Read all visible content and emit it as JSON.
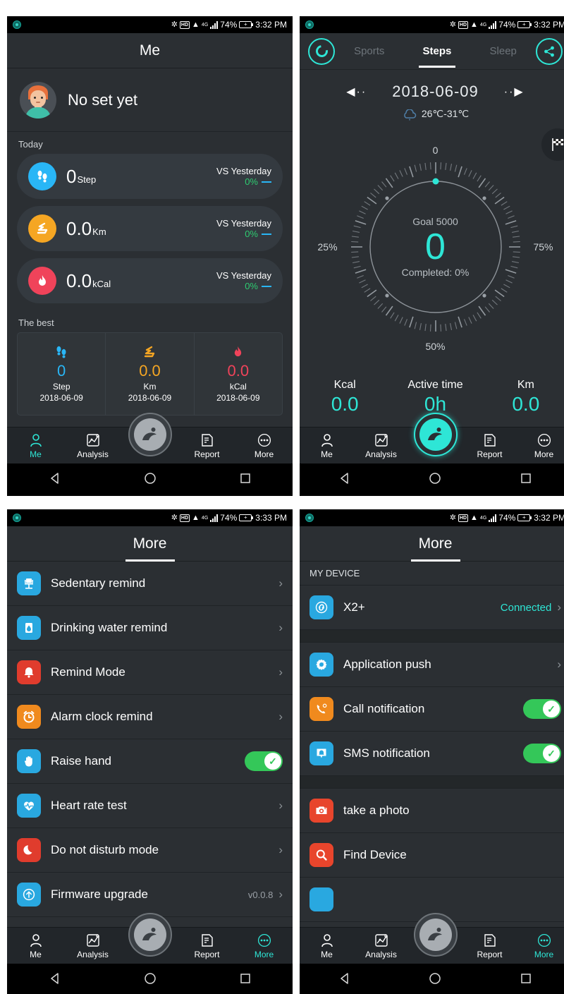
{
  "statusbar": {
    "battery_pct": "74%",
    "network": "4G",
    "hd": "HD",
    "time_332": "3:32 PM",
    "time_333": "3:33 PM"
  },
  "bottom_nav": {
    "items": [
      {
        "label": "Me",
        "icon": "person-icon"
      },
      {
        "label": "Analysis",
        "icon": "chart-icon"
      },
      {
        "label": "",
        "icon": "run-logo-icon"
      },
      {
        "label": "Report",
        "icon": "document-icon"
      },
      {
        "label": "More",
        "icon": "ellipsis-icon"
      }
    ]
  },
  "android_nav": {
    "back": "back-icon",
    "home": "home-icon",
    "recents": "recents-icon"
  },
  "me_page": {
    "title": "Me",
    "profile_name": "No set yet",
    "today_label": "Today",
    "today_stats": [
      {
        "icon": "footsteps-icon",
        "color": "#29b6f6",
        "value": "0",
        "unit": "Step",
        "vs_label": "VS Yesterday",
        "change": "0%"
      },
      {
        "icon": "distance-icon",
        "color": "#f5a623",
        "value": "0.0",
        "unit": "Km",
        "vs_label": "VS Yesterday",
        "change": "0%"
      },
      {
        "icon": "flame-icon",
        "color": "#f0435a",
        "value": "0.0",
        "unit": "kCal",
        "vs_label": "VS Yesterday",
        "change": "0%"
      }
    ],
    "best_label": "The best",
    "best_stats": [
      {
        "icon": "footsteps-icon",
        "color": "#29b6f6",
        "value": "0",
        "unit": "Step",
        "date": "2018-06-09"
      },
      {
        "icon": "distance-icon",
        "color": "#f5a623",
        "value": "0.0",
        "unit": "Km",
        "date": "2018-06-09"
      },
      {
        "icon": "flame-icon",
        "color": "#f0435a",
        "value": "0.0",
        "unit": "kCal",
        "date": "2018-06-09"
      }
    ]
  },
  "steps_page": {
    "tabs": [
      {
        "label": "Sports",
        "active": false
      },
      {
        "label": "Steps",
        "active": true
      },
      {
        "label": "Sleep",
        "active": false
      }
    ],
    "date": "2018-06-09",
    "prev_arrow": "◀··",
    "next_arrow": "··▶",
    "weather": "26℃-31℃",
    "gauge": {
      "top_label": "0",
      "right_label": "75%",
      "bottom_label": "50%",
      "left_label": "25%",
      "goal_label": "Goal 5000",
      "count": "0",
      "completed_label": "Completed: 0%",
      "progress_pct": 0,
      "accent": "#2ee6d6"
    },
    "metrics": [
      {
        "label": "Kcal",
        "value": "0.0"
      },
      {
        "label": "Active time",
        "value": "0h"
      },
      {
        "label": "Km",
        "value": "0.0"
      }
    ]
  },
  "more_page": {
    "title": "More",
    "rows": [
      {
        "label": "Sedentary remind",
        "icon": "chair-icon",
        "color": "#29a8e0",
        "control": "chevron"
      },
      {
        "label": "Drinking water remind",
        "icon": "water-glass-icon",
        "color": "#29a8e0",
        "control": "chevron"
      },
      {
        "label": "Remind Mode",
        "icon": "bell-icon",
        "color": "#e03c2d",
        "control": "chevron"
      },
      {
        "label": "Alarm clock remind",
        "icon": "alarm-clock-icon",
        "color": "#f08a1e",
        "control": "chevron"
      },
      {
        "label": "Raise hand",
        "icon": "hand-icon",
        "color": "#29a8e0",
        "control": "toggle",
        "on": true
      },
      {
        "label": "Heart rate test",
        "icon": "heart-pulse-icon",
        "color": "#29a8e0",
        "control": "chevron"
      },
      {
        "label": "Do not disturb mode",
        "icon": "moon-icon",
        "color": "#e03c2d",
        "control": "chevron"
      },
      {
        "label": "Firmware upgrade",
        "icon": "upload-circle-icon",
        "color": "#29a8e0",
        "control": "chevron",
        "value": "v0.0.8"
      }
    ]
  },
  "device_page": {
    "title": "More",
    "group_header": "MY DEVICE",
    "rows": [
      {
        "label": "X2+",
        "icon": "link-icon",
        "color": "#29a8e0",
        "control": "chevron",
        "value": "Connected",
        "value_style": "cyan"
      },
      {
        "label": "Application push",
        "icon": "gear-icon",
        "color": "#29a8e0",
        "control": "chevron"
      },
      {
        "label": "Call notification",
        "icon": "phone-bell-icon",
        "color": "#f08a1e",
        "control": "toggle",
        "on": true
      },
      {
        "label": "SMS notification",
        "icon": "message-bell-icon",
        "color": "#29a8e0",
        "control": "toggle",
        "on": true
      },
      {
        "label": "take a photo",
        "icon": "camera-icon",
        "color": "#e8452c",
        "control": "none"
      },
      {
        "label": "Find Device",
        "icon": "search-icon",
        "color": "#e8452c",
        "control": "none"
      }
    ]
  }
}
